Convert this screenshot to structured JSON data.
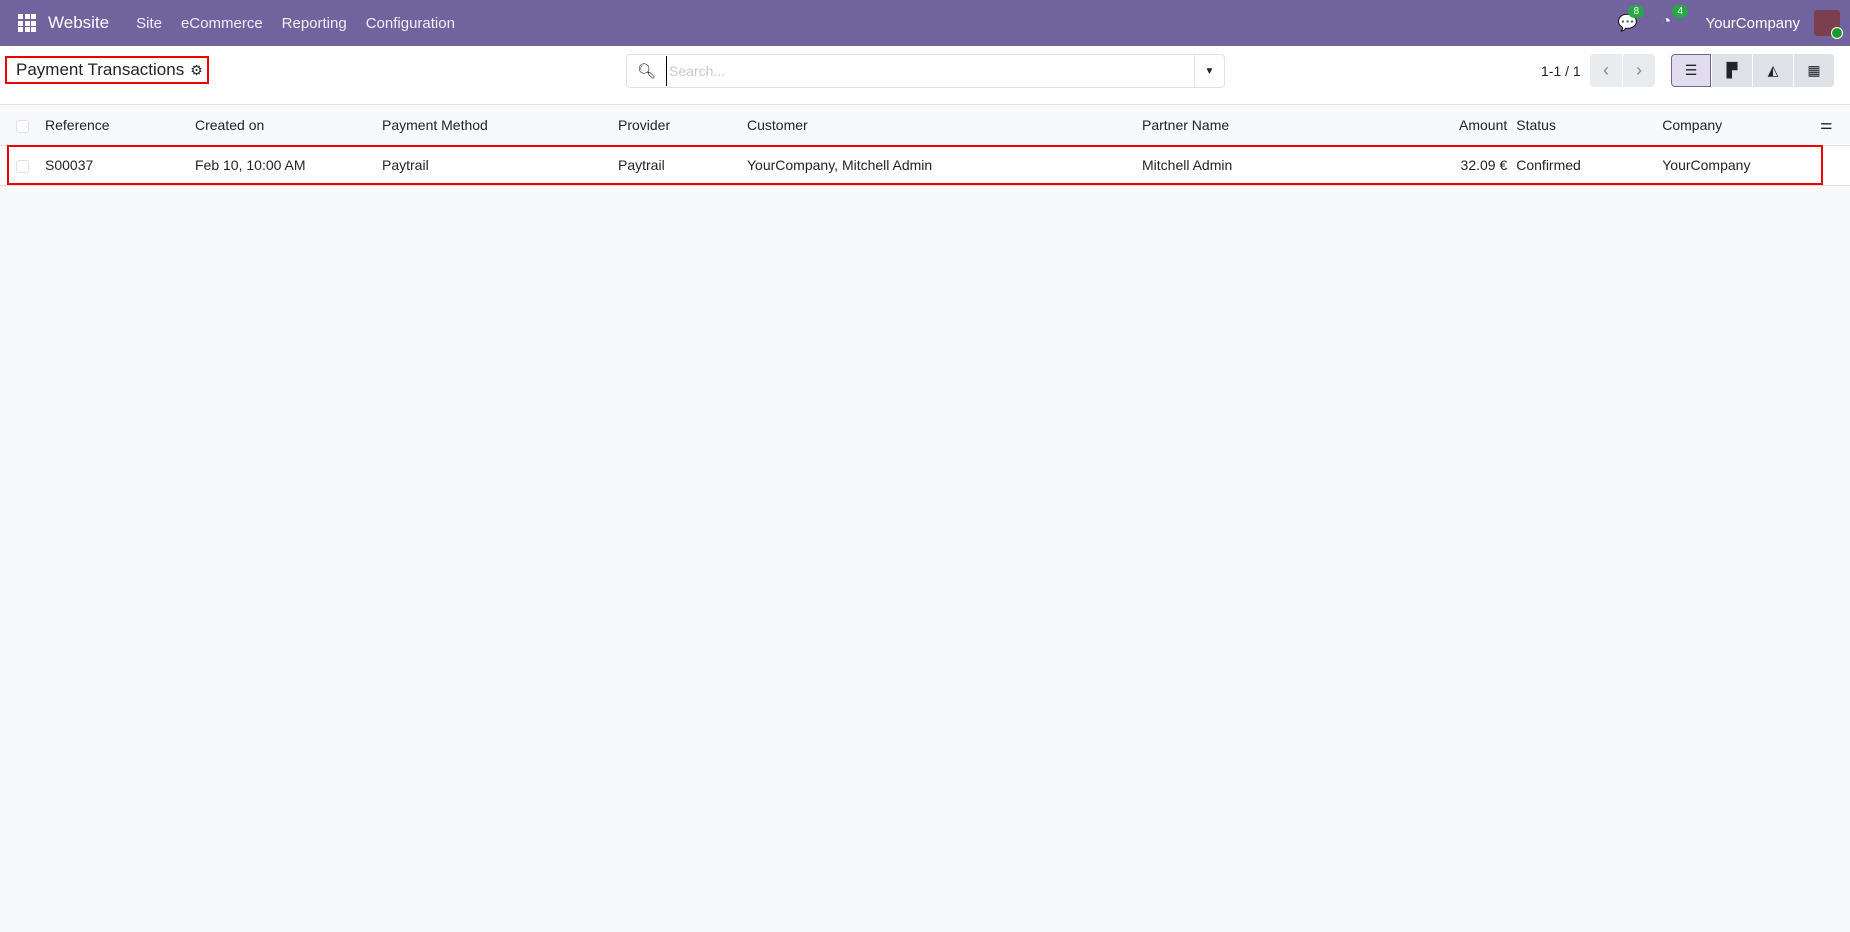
{
  "navbar": {
    "app": "Website",
    "menus": [
      "Site",
      "eCommerce",
      "Reporting",
      "Configuration"
    ],
    "messages_count": "8",
    "activities_count": "4",
    "company": "YourCompany"
  },
  "control_panel": {
    "title": "Payment Transactions",
    "search_placeholder": "Search...",
    "pager": "1-1 / 1"
  },
  "table": {
    "columns": [
      "Reference",
      "Created on",
      "Payment Method",
      "Provider",
      "Customer",
      "Partner Name",
      "Amount",
      "Status",
      "Company"
    ],
    "rows": [
      {
        "reference": "S00037",
        "created_on": "Feb 10, 10:00 AM",
        "payment_method": "Paytrail",
        "provider": "Paytrail",
        "customer": "YourCompany, Mitchell Admin",
        "partner_name": "Mitchell Admin",
        "amount": "32.09 €",
        "status": "Confirmed",
        "company": "YourCompany"
      }
    ]
  },
  "colors": {
    "navbar": "#71639e",
    "highlight": "#ee0000"
  }
}
